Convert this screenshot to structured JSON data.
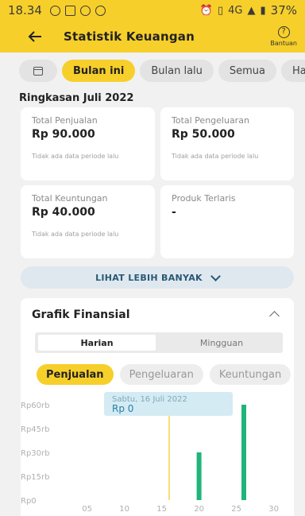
{
  "status": {
    "time": "18.34",
    "network": "4G",
    "battery": "37%"
  },
  "appbar": {
    "back_icon": "arrow-left-icon",
    "title": "Statistik Keuangan",
    "help_label": "Bantuan",
    "help_icon_glyph": "?"
  },
  "filters": {
    "items": [
      "Bulan ini",
      "Bulan lalu",
      "Semua",
      "Hari ini"
    ],
    "active": "Bulan ini"
  },
  "summary": {
    "title": "Ringkasan Juli 2022",
    "cards": [
      {
        "label": "Total Penjualan",
        "value": "Rp 90.000",
        "note": "Tidak ada data periode lalu"
      },
      {
        "label": "Total Pengeluaran",
        "value": "Rp 50.000",
        "note": "Tidak ada data periode lalu"
      },
      {
        "label": "Total Keuntungan",
        "value": "Rp 40.000",
        "note": "Tidak ada data periode lalu"
      },
      {
        "label": "Produk Terlaris",
        "value": "-",
        "note": ""
      }
    ],
    "more_label": "LIHAT LEBIH BANYAK"
  },
  "finance": {
    "title": "Grafik Finansial",
    "segments": [
      "Harian",
      "Mingguan"
    ],
    "active_segment": "Harian",
    "tabs": [
      "Penjualan",
      "Pengeluaran",
      "Keuntungan"
    ],
    "active_tab": "Penjualan"
  },
  "chart_data": {
    "type": "bar",
    "y_tick_labels": [
      "Rp60rb",
      "Rp45rb",
      "Rp30rb",
      "Rp15rb",
      "Rp0"
    ],
    "x_tick_labels": [
      "05",
      "10",
      "15",
      "20",
      "25",
      "30"
    ],
    "ylim": [
      0,
      60000
    ],
    "xlim": [
      1,
      31
    ],
    "points": [
      {
        "x": 20,
        "value": 30000
      },
      {
        "x": 26,
        "value": 60000
      }
    ],
    "selected_day": 16,
    "tooltip": {
      "date": "Sabtu, 16 Juli 2022",
      "value": "Rp 0"
    },
    "colors": {
      "bar": "#1fb57a",
      "selection": "#f2d34a",
      "tooltip_bg": "#d4ebf4",
      "tooltip_date": "#7fa9b9",
      "tooltip_value": "#2a7fa0",
      "axis_text": "#b0b0b0"
    }
  }
}
